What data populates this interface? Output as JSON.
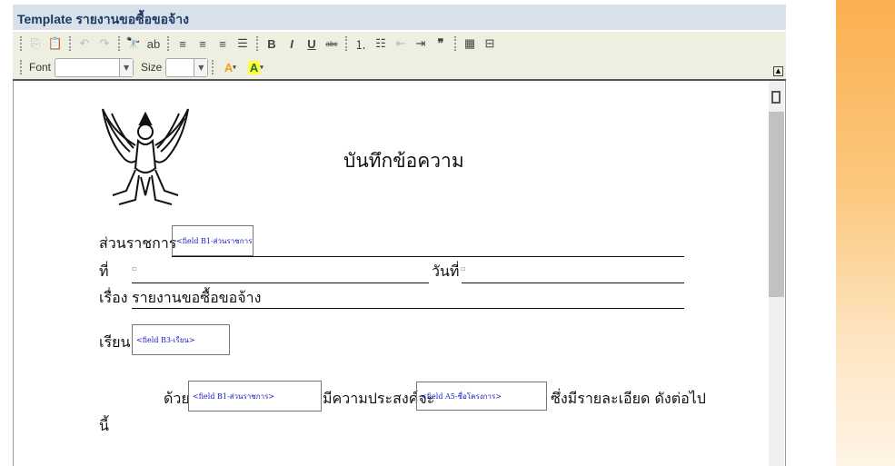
{
  "header": {
    "title": "Template รายงานขอซื้อขอจ้าง"
  },
  "toolbar": {
    "font_label": "Font",
    "size_label": "Size",
    "font_value": "",
    "size_value": ""
  },
  "document": {
    "title": "บันทึกข้อความ",
    "agency_label": "ส่วนราชการ",
    "agency_field": "<field B1-ส่วนราชการ>",
    "ref_label": "ที่",
    "date_label": "วันที่",
    "subject_label": "เรื่อง",
    "subject_value": "รายงานขอซื้อขอจ้าง",
    "to_label": "เรียน",
    "to_field": "<field B3-เรียน>",
    "body_prefix": "ด้วย",
    "body_field1": "<field B1-ส่วนราชการ>",
    "body_mid": "มีความประสงค์จะ",
    "body_field2": "<field A5-ชื่อโครงการ>",
    "body_suffix": "ซึ่งมีรายละเอียด ดังต่อไป",
    "body_wrap": "นี้"
  }
}
